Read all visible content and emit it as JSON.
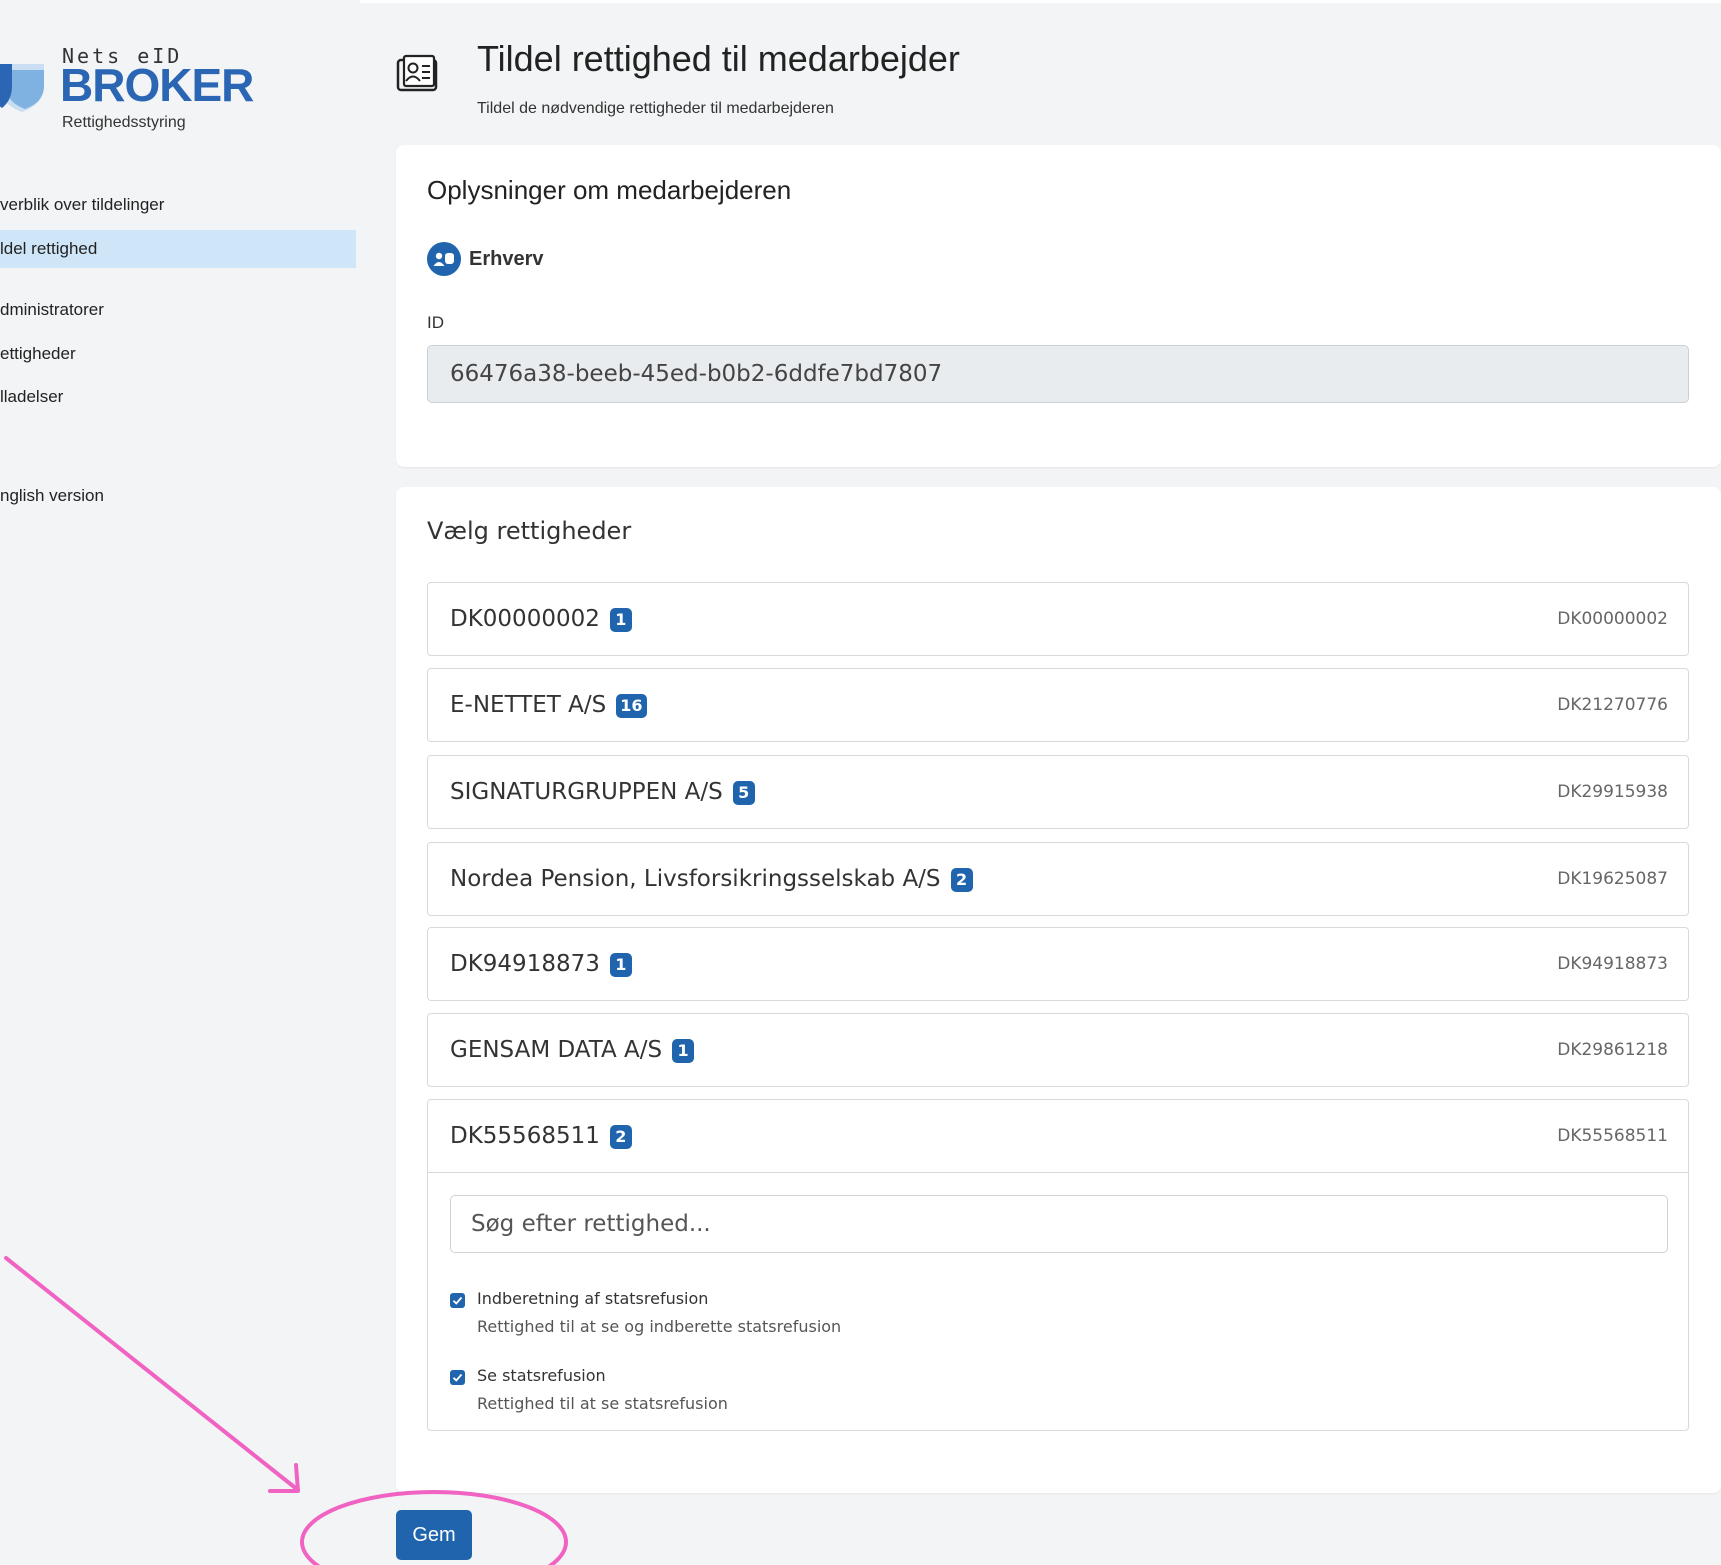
{
  "logo": {
    "top_text": "Nets eID",
    "main_text": "BROKER",
    "sub_text": "Rettighedsstyring"
  },
  "sidebar": {
    "items": [
      {
        "label": "verblik over tildelinger",
        "active": false
      },
      {
        "label": "ldel rettighed",
        "active": true
      },
      {
        "label": "dministratorer",
        "active": false
      },
      {
        "label": "ettigheder",
        "active": false
      },
      {
        "label": "lladelser",
        "active": false
      },
      {
        "label": "nglish version",
        "active": false
      }
    ]
  },
  "header": {
    "title": "Tildel rettighed til medarbejder",
    "subtitle": "Tildel de nødvendige rettigheder til medarbejderen"
  },
  "employee": {
    "heading": "Oplysninger om medarbejderen",
    "type": "Erhverv",
    "id_label": "ID",
    "id_value": "66476a38-beeb-45ed-b0b2-6ddfe7bd7807"
  },
  "rights": {
    "heading": "Vælg rettigheder",
    "organizations": [
      {
        "name": "DK00000002",
        "count": "1",
        "code": "DK00000002"
      },
      {
        "name": "E-NETTET A/S",
        "count": "16",
        "code": "DK21270776"
      },
      {
        "name": "SIGNATURGRUPPEN A/S",
        "count": "5",
        "code": "DK29915938"
      },
      {
        "name": "Nordea Pension, Livsforsikringsselskab A/S",
        "count": "2",
        "code": "DK19625087"
      },
      {
        "name": "DK94918873",
        "count": "1",
        "code": "DK94918873"
      },
      {
        "name": "GENSAM DATA A/S",
        "count": "1",
        "code": "DK29861218"
      }
    ],
    "expanded": {
      "name": "DK55568511",
      "count": "2",
      "code": "DK55568511",
      "search_placeholder": "Søg efter rettighed...",
      "permissions": [
        {
          "title": "Indberetning af statsrefusion",
          "description": "Rettighed til at se og indberette statsrefusion",
          "checked": true
        },
        {
          "title": "Se statsrefusion",
          "description": "Rettighed til at se statsrefusion",
          "checked": true
        }
      ]
    }
  },
  "actions": {
    "save_label": "Gem"
  },
  "colors": {
    "primary": "#1f64ad",
    "active_nav": "#cfe6f8",
    "annotation": "#f063c2"
  }
}
